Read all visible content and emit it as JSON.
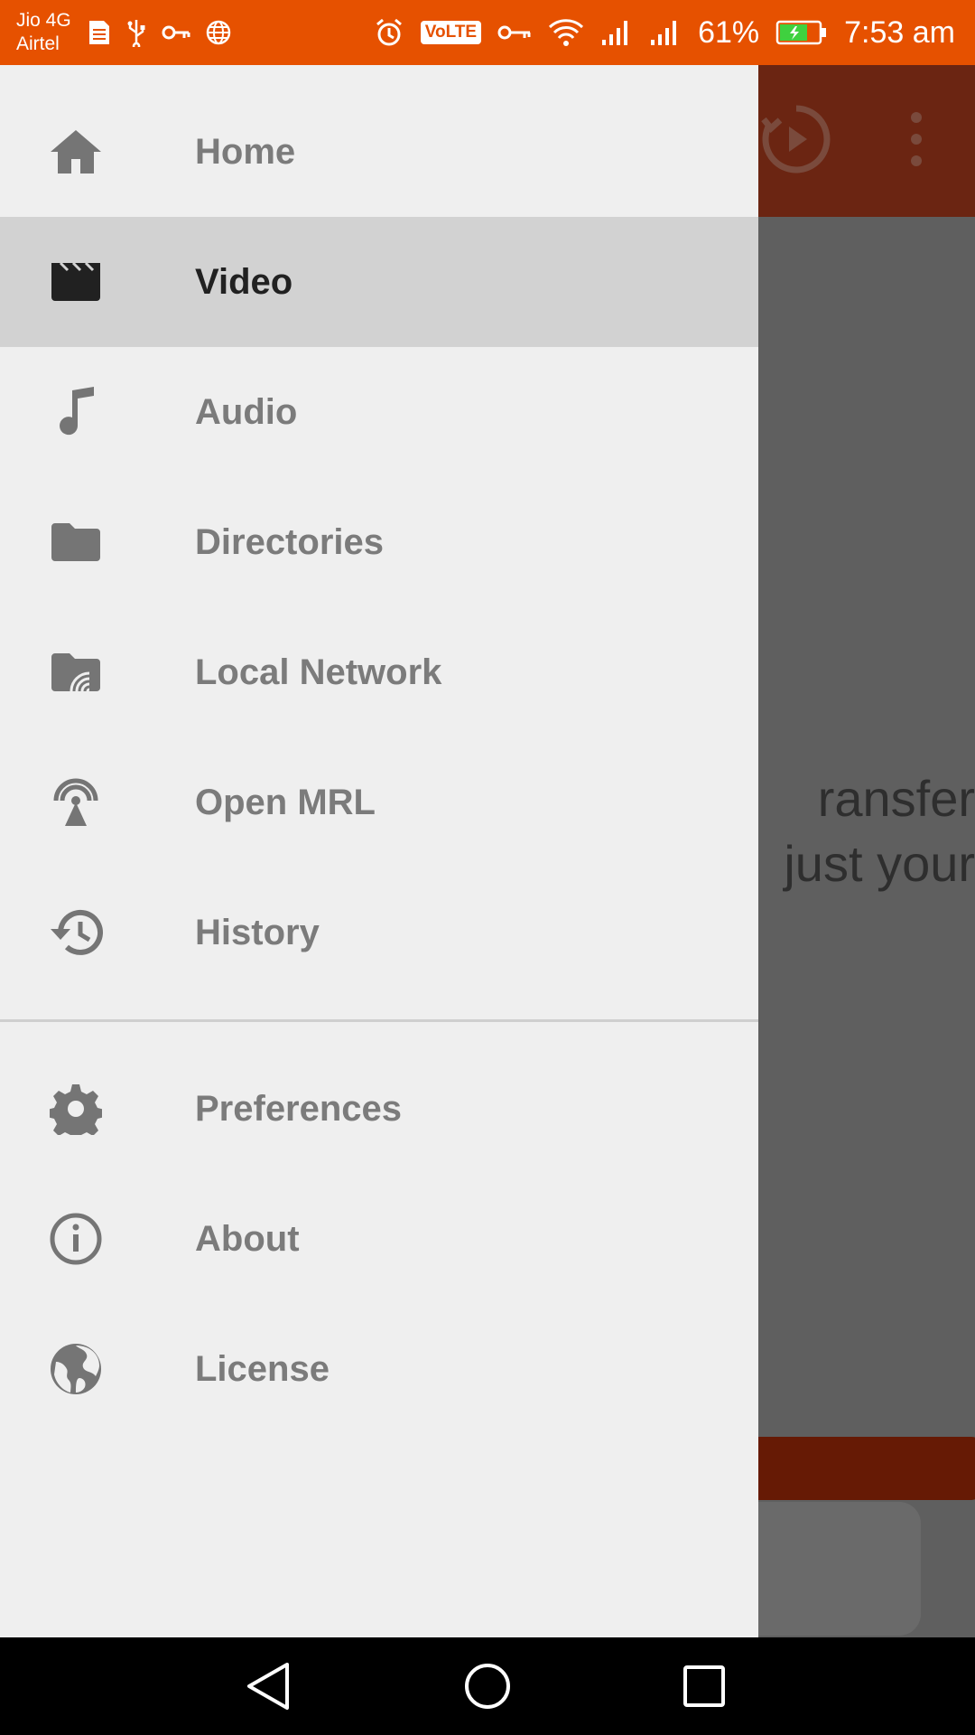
{
  "status_bar": {
    "carrier_primary": "Jio 4G",
    "carrier_secondary": "Airtel",
    "battery": "61%",
    "time": "7:53 am",
    "volte": "VoLTE"
  },
  "background": {
    "text_line_1": "ransfer",
    "text_line_2": "just your"
  },
  "drawer": {
    "items": [
      {
        "label": "Home",
        "icon": "home-icon"
      },
      {
        "label": "Video",
        "icon": "clapperboard-icon",
        "active": true
      },
      {
        "label": "Audio",
        "icon": "music-note-icon"
      },
      {
        "label": "Directories",
        "icon": "folder-icon"
      },
      {
        "label": "Local Network",
        "icon": "network-folder-icon"
      },
      {
        "label": "Open MRL",
        "icon": "broadcast-icon"
      },
      {
        "label": "History",
        "icon": "history-icon"
      }
    ],
    "secondary_items": [
      {
        "label": "Preferences",
        "icon": "gear-icon"
      },
      {
        "label": "About",
        "icon": "info-icon"
      },
      {
        "label": "License",
        "icon": "globe-icon"
      }
    ]
  },
  "colors": {
    "status_bar": "#e65100",
    "drawer_bg": "#efefef",
    "active_item_bg": "#d2d2d2",
    "icon_grey": "#757575",
    "active_text": "#212121"
  }
}
